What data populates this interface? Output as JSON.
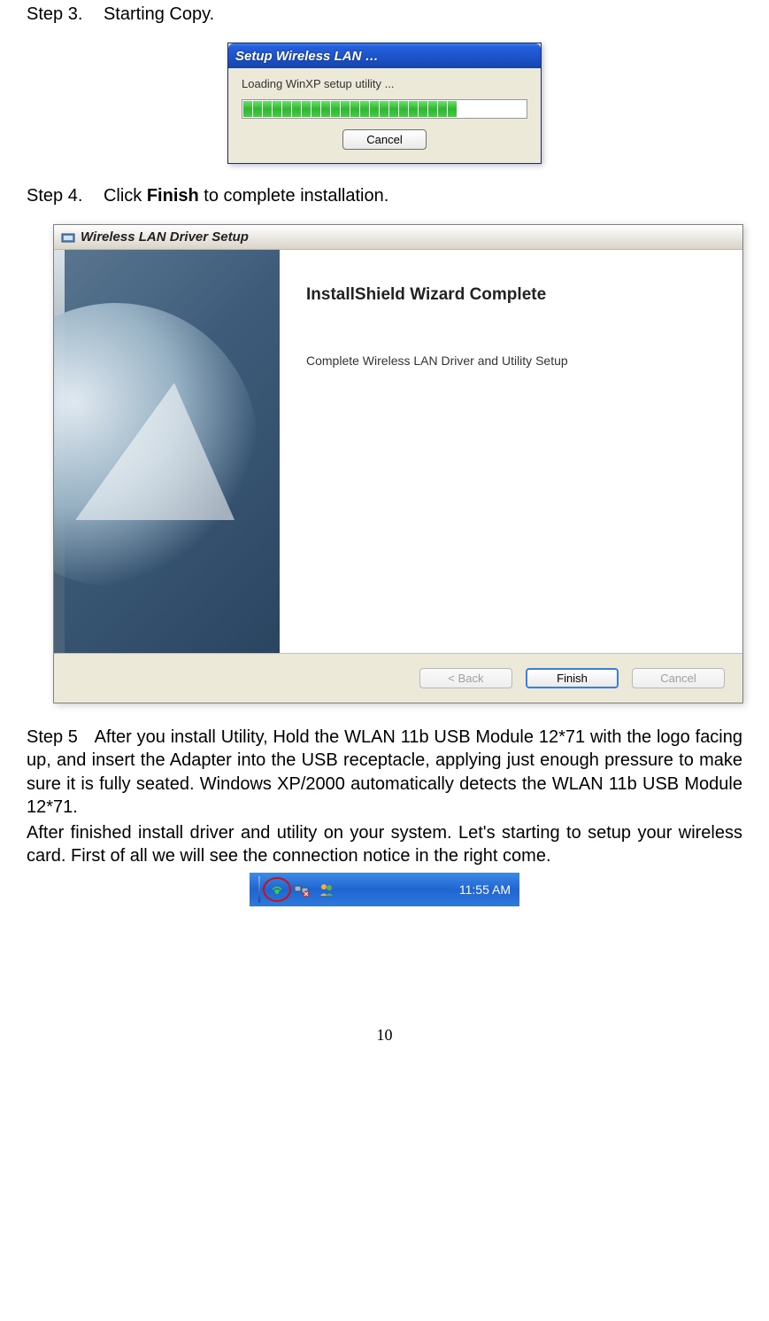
{
  "step3": {
    "label": "Step 3.",
    "text": "Starting Copy."
  },
  "dialog1": {
    "title": "Setup Wireless LAN …",
    "loading": "Loading WinXP setup utility ...",
    "cancel": "Cancel"
  },
  "step4": {
    "label": "Step 4.",
    "pre": "Click ",
    "bold": "Finish",
    "post": " to complete installation."
  },
  "dialog2": {
    "title": "Wireless LAN Driver Setup",
    "heading": "InstallShield Wizard Complete",
    "body": "Complete Wireless LAN Driver and Utility Setup",
    "back": "< Back",
    "finish": "Finish",
    "cancel": "Cancel"
  },
  "step5": {
    "label": "Step 5",
    "para1": "After you install Utility, Hold the WLAN 11b USB Module 12*71 with the logo facing up, and insert the Adapter into the USB receptacle, applying just enough pressure to make sure it is fully seated. Windows XP/2000 automatically detects the WLAN 11b USB Module 12*71.",
    "para2": "After finished install driver and utility on your system. Let's starting to setup your wireless card. First of all we will see the connection notice in the right come."
  },
  "tray": {
    "time": "11:55 AM"
  },
  "page": {
    "number": "10"
  }
}
